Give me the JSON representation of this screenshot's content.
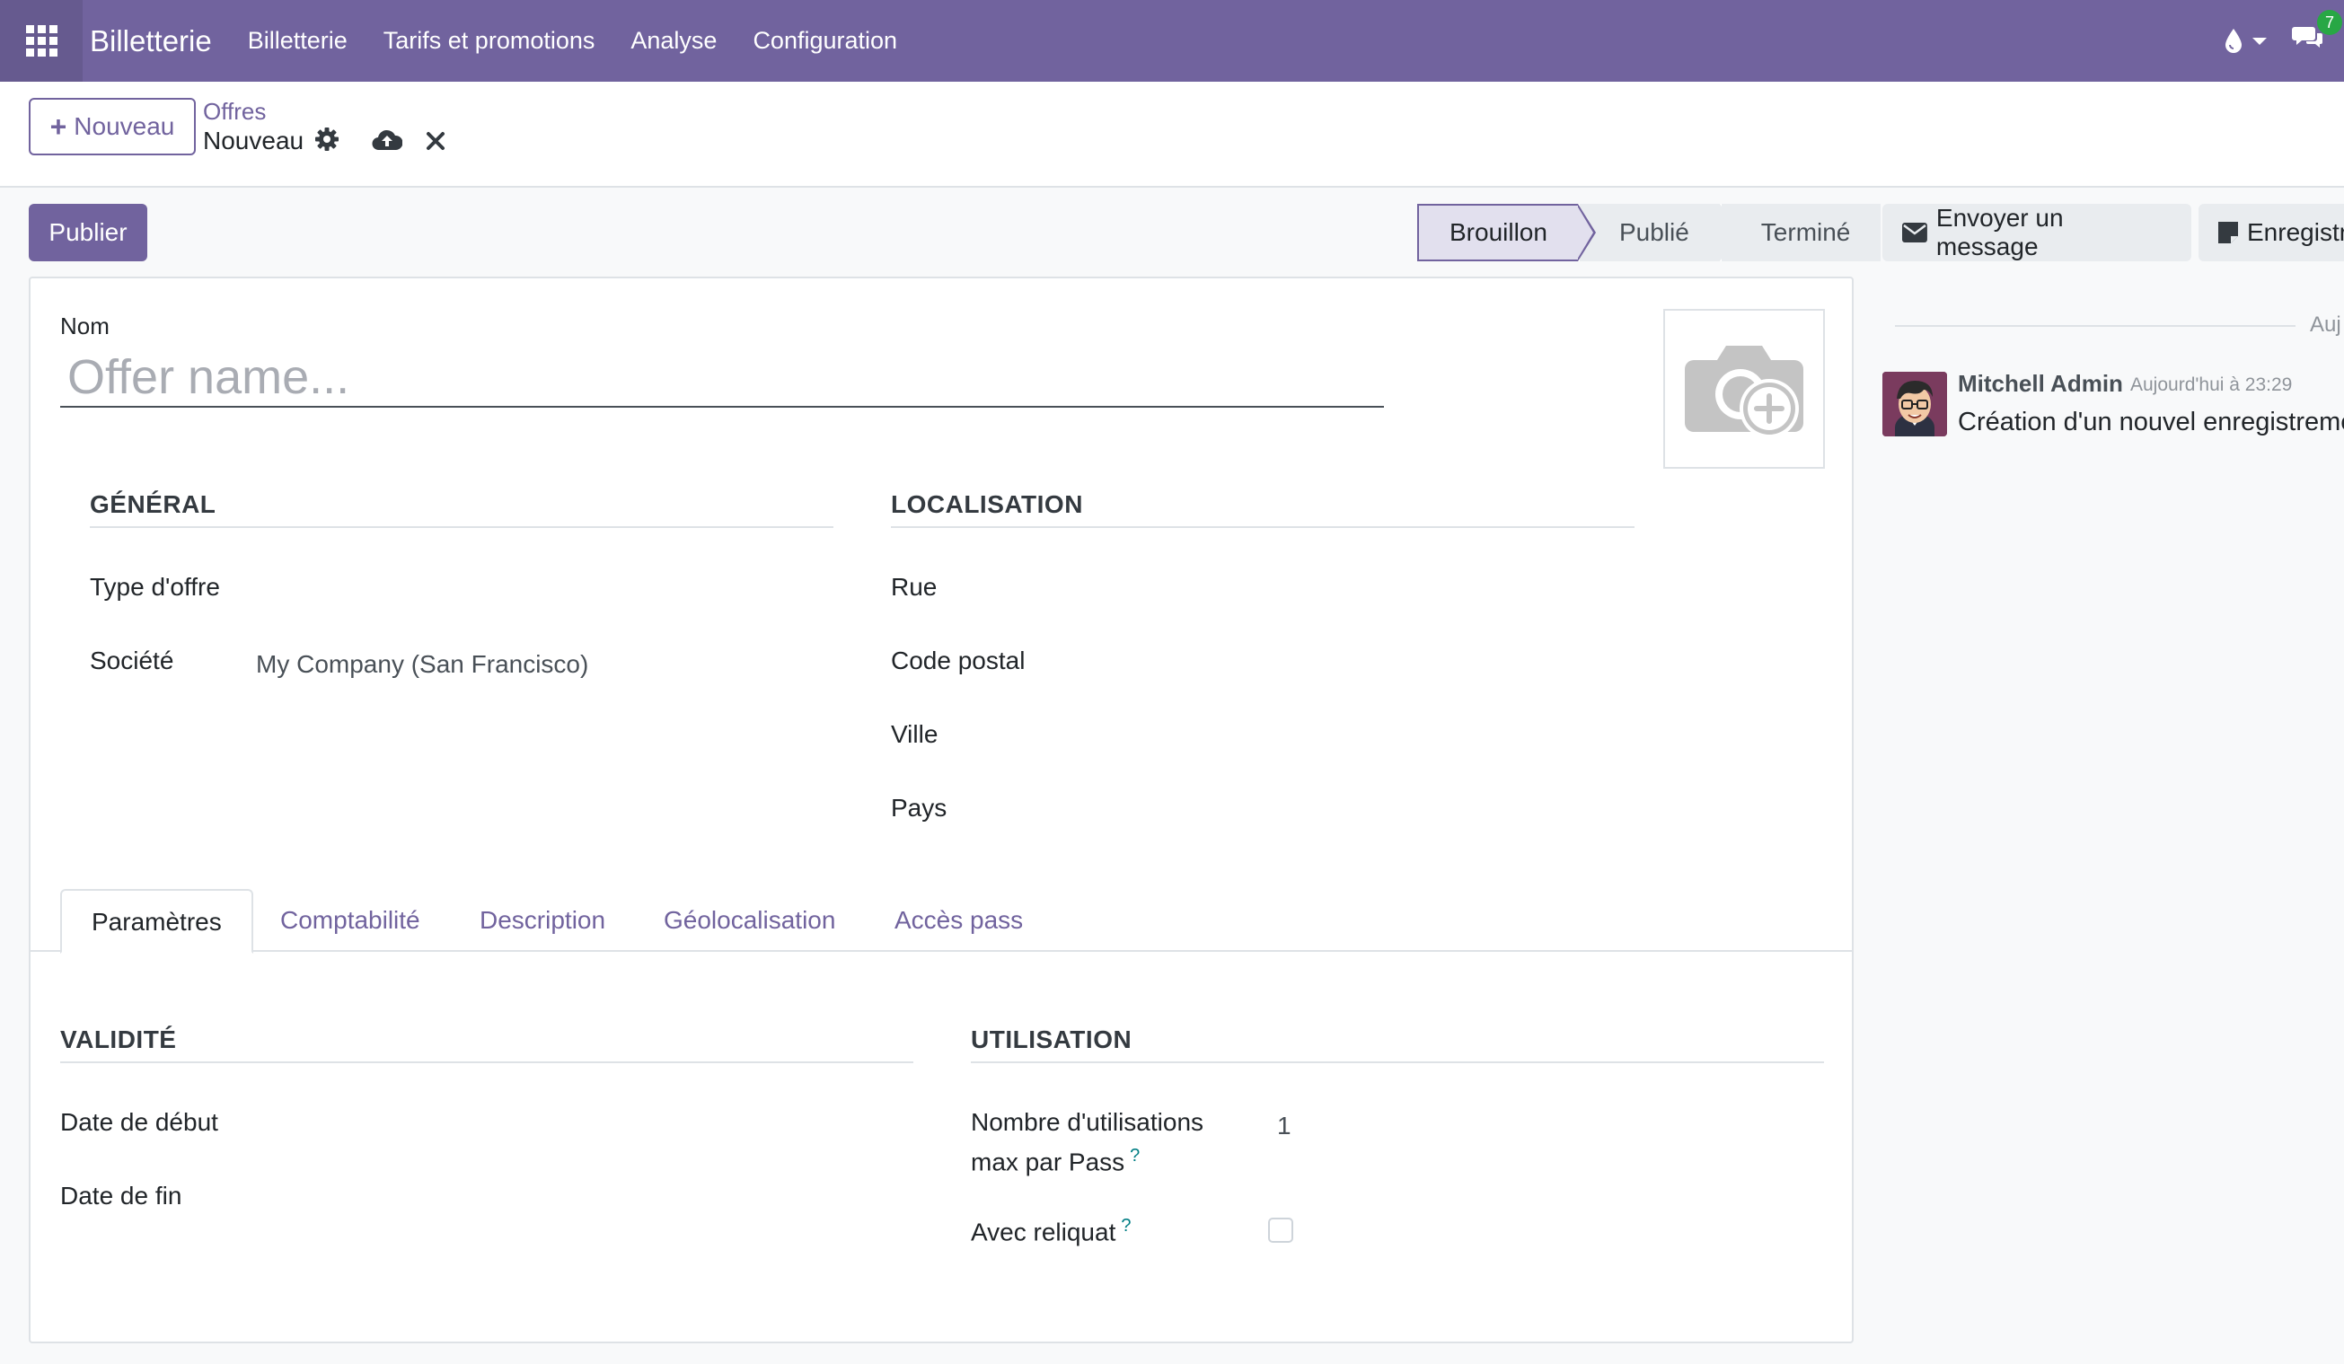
{
  "navbar": {
    "brand": "Billetterie",
    "menu": [
      "Billetterie",
      "Tarifs et promotions",
      "Analyse",
      "Configuration"
    ],
    "notification_count": "7"
  },
  "control_panel": {
    "new_button": "Nouveau",
    "breadcrumb_parent": "Offres",
    "breadcrumb_current": "Nouveau"
  },
  "actions": {
    "publish": "Publier",
    "stages": [
      "Brouillon",
      "Publié",
      "Terminé"
    ],
    "active_stage": "Brouillon",
    "send_message": "Envoyer un message",
    "log_note": "Enregistr"
  },
  "form": {
    "name_label": "Nom",
    "name_placeholder": "Offer name...",
    "general": {
      "title": "GÉNÉRAL",
      "offer_type_label": "Type d'offre",
      "company_label": "Société",
      "company_value": "My Company (San Francisco)"
    },
    "location": {
      "title": "LOCALISATION",
      "street_label": "Rue",
      "zip_label": "Code postal",
      "city_label": "Ville",
      "country_label": "Pays"
    },
    "tabs": [
      "Paramètres",
      "Comptabilité",
      "Description",
      "Géolocalisation",
      "Accès pass"
    ],
    "active_tab": "Paramètres",
    "validity": {
      "title": "VALIDITÉ",
      "start_label": "Date de début",
      "end_label": "Date de fin"
    },
    "usage": {
      "title": "UTILISATION",
      "max_uses_label_1": "Nombre d'utilisations",
      "max_uses_label_2": "max par Pass",
      "max_uses_value": "1",
      "remainder_label": "Avec reliquat",
      "remainder_checked": false
    }
  },
  "chatter": {
    "date_separator": "Auj",
    "message": {
      "author": "Mitchell Admin",
      "date": "Aujourd'hui à 23:29",
      "body": "Création d'un nouvel enregistreme"
    }
  },
  "colors": {
    "brand": "#71639e",
    "brand_dark": "#665a8f",
    "badge": "#28a745"
  }
}
